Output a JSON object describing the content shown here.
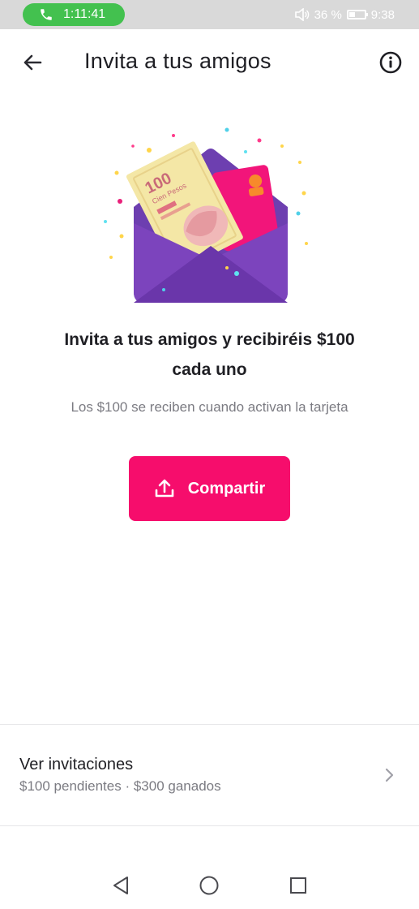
{
  "status_bar": {
    "call_timer": "1:11:41",
    "battery_percent": "36 %",
    "time": "9:38",
    "colors": {
      "call_pill": "#43c14f",
      "bar": "#d9d9d9"
    }
  },
  "header": {
    "title": "Invita a tus amigos",
    "back_icon": "arrow-left-icon",
    "info_icon": "info-circle-icon"
  },
  "illustration": {
    "banknote_value": "100",
    "banknote_text": "Cien Pesos"
  },
  "main": {
    "headline_line1": "Invita a tus amigos y recibiréis $100",
    "headline_line2": "cada uno",
    "subtext": "Los $100 se reciben cuando activan la tarjeta",
    "share_button": {
      "label": "Compartir",
      "icon": "share-upload-icon",
      "color": "#f60d6c"
    }
  },
  "invitations": {
    "title": "Ver invitaciones",
    "summary": "$100 pendientes · $300 ganados",
    "icon": "chevron-right-icon"
  },
  "nav_bar": {
    "back": "triangle-back-icon",
    "home": "circle-home-icon",
    "recents": "square-recents-icon"
  }
}
